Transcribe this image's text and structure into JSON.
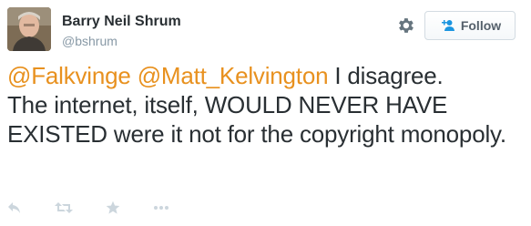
{
  "user": {
    "full_name": "Barry Neil Shrum",
    "username": "@bshrum"
  },
  "follow_button": {
    "label": "Follow"
  },
  "tweet": {
    "mention_1": "@Falkvinge",
    "mention_2": "@Matt_Kelvington",
    "text_line_1": " I disagree.",
    "text_rest": "The internet, itself, WOULD NEVER HAVE EXISTED were it not for the copyright monopoly."
  },
  "icons": {
    "settings": "gear-icon",
    "follow": "add-user-icon",
    "reply": "reply-icon",
    "retweet": "retweet-icon",
    "favorite": "star-icon",
    "more": "more-icon"
  },
  "colors": {
    "mention": "#e8911f",
    "text": "#292f33",
    "muted": "#8899a6",
    "follow_icon": "#1b95e0",
    "action_icon": "#ccd6dd"
  }
}
